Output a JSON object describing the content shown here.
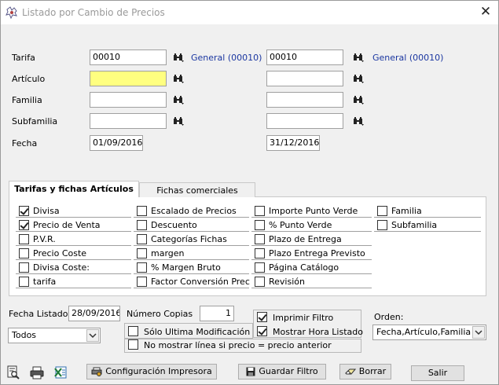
{
  "window": {
    "title": "Listado por Cambio de Precios",
    "close_glyph": "✕"
  },
  "filters": {
    "tarifa": {
      "label": "Tarifa",
      "from_value": "00010",
      "from_desc": "General (00010)",
      "to_value": "00010",
      "to_desc": "General (00010)"
    },
    "articulo": {
      "label": "Artículo",
      "from_value": "",
      "to_value": ""
    },
    "familia": {
      "label": "Familia",
      "from_value": "",
      "to_value": ""
    },
    "subfamilia": {
      "label": "Subfamilia",
      "from_value": "",
      "to_value": ""
    },
    "fecha": {
      "label": "Fecha",
      "from_value": "01/09/2016",
      "to_value": "31/12/2016"
    }
  },
  "tabs": [
    {
      "label": "Tarifas y fichas Artículos",
      "active": true
    },
    {
      "label": "Fichas comerciales",
      "active": false
    }
  ],
  "fields": {
    "col1": [
      {
        "label": "Divisa",
        "checked": true
      },
      {
        "label": "Precio de Venta",
        "checked": true
      },
      {
        "label": "P.V.R.",
        "checked": false
      },
      {
        "label": "Precio Coste",
        "checked": false
      },
      {
        "label": "Divisa Coste:",
        "checked": false
      },
      {
        "label": "tarifa",
        "checked": false
      }
    ],
    "col2": [
      {
        "label": "Escalado de Precios",
        "checked": false
      },
      {
        "label": "Descuento",
        "checked": false
      },
      {
        "label": "Categorías Fichas",
        "checked": false
      },
      {
        "label": "margen",
        "checked": false
      },
      {
        "label": "% Margen Bruto",
        "checked": false
      },
      {
        "label": "Factor Conversión Prec",
        "checked": false
      }
    ],
    "col3": [
      {
        "label": "Importe Punto Verde",
        "checked": false
      },
      {
        "label": "% Punto Verde",
        "checked": false
      },
      {
        "label": "Plazo de Entrega",
        "checked": false
      },
      {
        "label": "Plazo Entrega Previsto",
        "checked": false
      },
      {
        "label": "Página Catálogo",
        "checked": false
      },
      {
        "label": "Revisión",
        "checked": false
      }
    ],
    "col4": [
      {
        "label": "Familia",
        "checked": false
      },
      {
        "label": "Subfamilia",
        "checked": false
      }
    ]
  },
  "options": {
    "fecha_listado_label": "Fecha Listado",
    "fecha_listado_value": "28/09/2016",
    "numero_copias_label": "Número Copias",
    "numero_copias_value": "1",
    "todos_value": "Todos",
    "imprimir_filtro": {
      "label": "Imprimir Filtro",
      "checked": true
    },
    "mostrar_hora": {
      "label": "Mostrar Hora Listado",
      "checked": true
    },
    "solo_ultima": {
      "label": "Sólo Ultima Modificación",
      "checked": false
    },
    "no_mostrar": {
      "label": "No mostrar línea si precio = precio anterior",
      "checked": false
    },
    "orden_label": "Orden:",
    "orden_value": "Fecha,Artículo,Familia"
  },
  "buttons": {
    "configuracion": "Configuración Impresora",
    "guardar": "Guardar Filtro",
    "borrar": "Borrar",
    "salir": "Salir"
  }
}
